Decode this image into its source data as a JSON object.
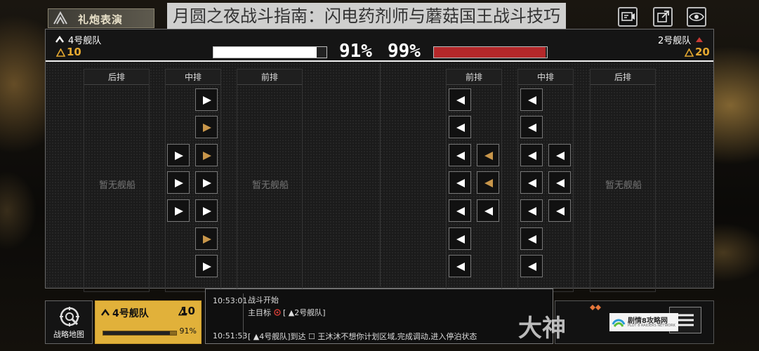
{
  "top": {
    "event_label": "礼炮表演",
    "headline": "月圆之夜战斗指南：闪电药剂师与蘑菇国王战斗技巧",
    "icons": [
      "screen-record-icon",
      "share-icon",
      "eye-icon"
    ]
  },
  "battle": {
    "left": {
      "name": "4号舰队",
      "count": "10",
      "hp_percent": 91,
      "hp_label": "91%"
    },
    "right": {
      "name": "2号舰队",
      "count": "20",
      "hp_percent": 99,
      "hp_label": "99%"
    },
    "rows": {
      "back": "后排",
      "mid": "中排",
      "front": "前排"
    },
    "empty_label": "暂无舰船",
    "colors": {
      "white_ship": "#ffffff",
      "gold_ship": "#c8964a",
      "enemy_hp": "#b4282a",
      "fleet_card": "#e1b13a"
    }
  },
  "bottom": {
    "map_label": "战略地图",
    "fleet_name": "4号舰队",
    "fleet_count": "10",
    "fleet_hp": "91%",
    "fleet_hp_value": 0.91,
    "log": [
      {
        "time": "10:53:01",
        "line1": "战斗开始",
        "line2_prefix": "主目标",
        "line2_target": "[ ▲2号舰队]"
      },
      {
        "time": "10:51:53",
        "line1": "[ ▲4号舰队]到达 ☐ 王沐沐不想你计划区域,完成调动,进入停泊状态"
      }
    ]
  },
  "watermark": {
    "dashen": "大神",
    "brand": "剧情8攻略网",
    "brand_en": "PLOT 8 RAIDERS NETWORK"
  }
}
